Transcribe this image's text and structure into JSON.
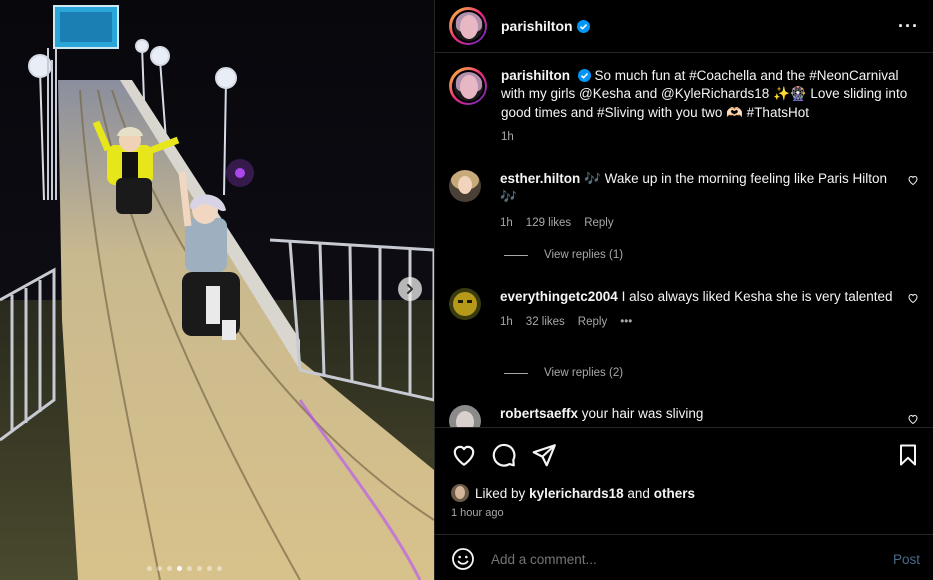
{
  "post": {
    "username": "parishilton",
    "more_icon": "more-horizontal-icon"
  },
  "caption": {
    "username": "parishilton",
    "text": "So much fun at #Coachella and the #NeonCarnival with my girls @Kesha and @KyleRichards18 ✨🎡 Love sliding into good times and #Sliving with you two 🫶🏻 #ThatsHot",
    "time": "1h"
  },
  "comments": [
    {
      "username": "esther.hilton",
      "text": "🎶 Wake up in the morning feeling like Paris Hilton 🎶",
      "time": "1h",
      "likes": "129 likes",
      "reply": "Reply",
      "view_replies": "View replies (1)"
    },
    {
      "username": "everythingetc2004",
      "text": "I also always liked Kesha she is very talented",
      "time": "1h",
      "likes": "32 likes",
      "reply": "Reply",
      "more": "•••",
      "view_replies": "View replies (2)"
    },
    {
      "username": "robertsaeffx",
      "text": "your hair was sliving"
    }
  ],
  "actions": {
    "liked_by_prefix": "Liked by",
    "liked_by_user": "kylerichards18",
    "liked_by_and": "and",
    "liked_by_others": "others",
    "time": "1 hour ago"
  },
  "add_comment": {
    "placeholder": "Add a comment...",
    "post_label": "Post"
  },
  "carousel": {
    "total_dots": 8,
    "active_index": 3
  },
  "colors": {
    "background": "#000000",
    "verified": "#0095f6",
    "post_disabled": "#4a6a8a",
    "muted": "#a8a8a8"
  }
}
